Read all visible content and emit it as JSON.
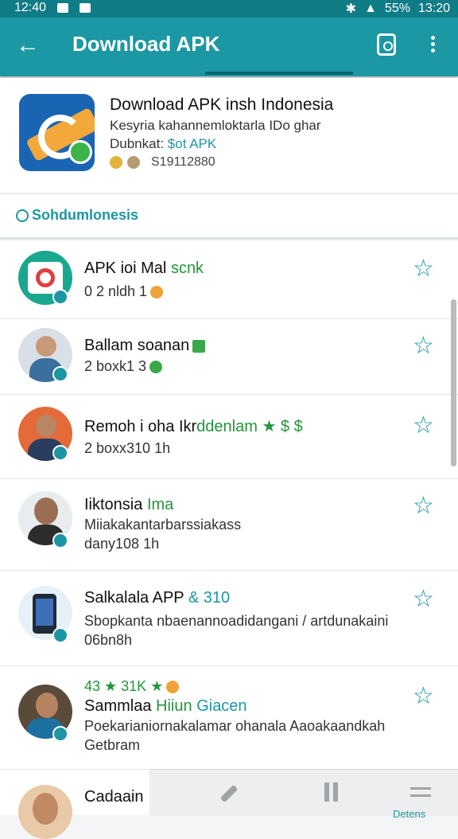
{
  "statusbar": {
    "time_left": "12:40",
    "battery": "55%",
    "time_right": "13:20"
  },
  "appbar": {
    "title": "Download APK"
  },
  "app": {
    "title": "Download APK insh Indonesia",
    "desc": "Kesyria kahannemloktarla IDo ghar",
    "sub_prefix": "Dubnkat:",
    "sub_accent": "$ot APK",
    "meta": "S19112880"
  },
  "section": {
    "label": "Sohdumlonesis"
  },
  "items": [
    {
      "name": "APK ioi Mal",
      "name_tag": "scnk",
      "line2": "0 2 nldh 1",
      "line3": ""
    },
    {
      "name": "Ballam soanan",
      "name_tag": "",
      "line2": "2 boxk1 3",
      "line3": ""
    },
    {
      "name": "Remoh i oha Ikr",
      "name_tag": "ddenlam ★ $ $",
      "line2": "2 boxx310 1h",
      "line3": ""
    },
    {
      "name": "Iiktonsia",
      "name_tag": "Ima",
      "line2": "Miiakakantarbarssiakass",
      "line3": "dany108 1h"
    },
    {
      "name": "Salkalala APP",
      "name_tag": "& 310",
      "line2": "Sbopkanta nbaenannoadidangani / artdunakaini",
      "line3": "06bn8h"
    },
    {
      "name": "Sammlaa",
      "name_tag": "Hiiun",
      "name_tag2": "Giacen",
      "pre": "43 ★ 31K ★",
      "line2": "Poekarianiornakalamar ohanala Aaoakaandkah",
      "line3": "Getbram"
    },
    {
      "name": "Cadaain",
      "name_tag": "",
      "line2": "",
      "line3": ""
    }
  ],
  "bottombar": {
    "label": "Detens"
  },
  "colors": {
    "primary": "#1b98a3",
    "status": "#0f7c86",
    "accent": "#1c96a4",
    "green": "#23963a"
  },
  "icons": [
    "back-arrow-icon",
    "share-icon",
    "more-vert-icon",
    "star-outline-icon",
    "pen-icon",
    "pause-icon",
    "menu-icon"
  ]
}
